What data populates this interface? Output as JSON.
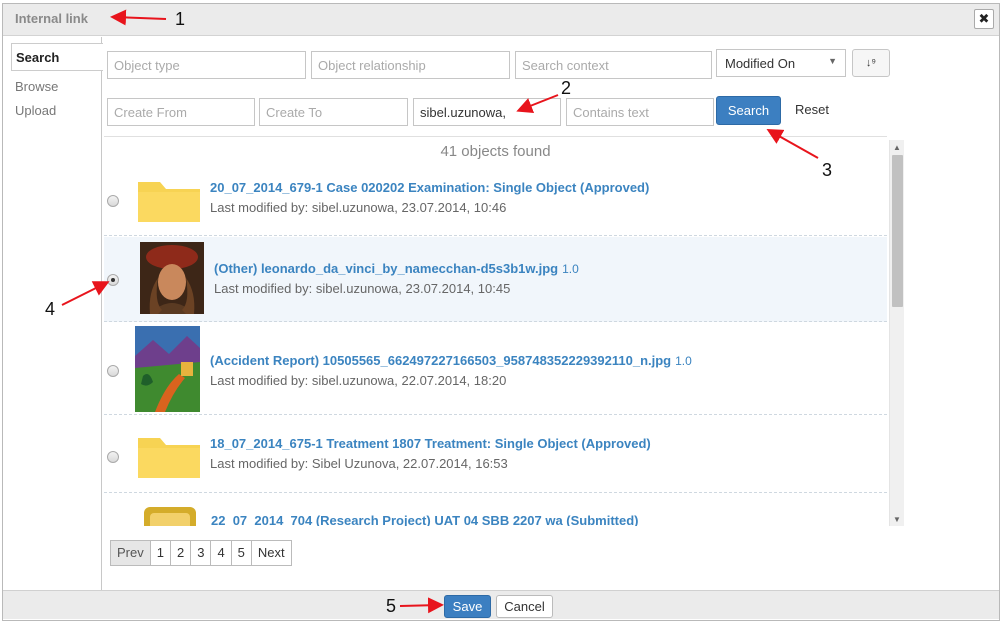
{
  "dialog": {
    "title": "Internal link",
    "close_glyph": "✖"
  },
  "sidebar": {
    "items": [
      {
        "label": "Search"
      },
      {
        "label": "Browse"
      },
      {
        "label": "Upload"
      }
    ]
  },
  "filters": {
    "object_type": "Object type",
    "object_relationship": "Object relationship",
    "search_context": "Search context",
    "sort_by": "Modified On",
    "sort_glyph": "↓⁹",
    "create_from": "Create From",
    "create_to": "Create To",
    "user": "sibel.uzunowa,",
    "contains_text": "Contains text",
    "search_label": "Search",
    "reset_label": "Reset"
  },
  "results": {
    "count_text": "41 objects found",
    "items": [
      {
        "title": "20_07_2014_679-1 Case 020202 Examination: Single Object (Approved)",
        "version": "",
        "modified": "Last modified by: sibel.uzunowa, 23.07.2014, 10:46",
        "thumbnail": "folder-icon"
      },
      {
        "title": "(Other) leonardo_da_vinci_by_namecchan-d5s3b1w.jpg",
        "version": "1.0",
        "modified": "Last modified by: sibel.uzunowa, 23.07.2014, 10:45",
        "thumbnail": "portrait-thumbnail"
      },
      {
        "title": "(Accident Report) 10505565_662497227166503_958748352229392110_n.jpg",
        "version": "1.0",
        "modified": "Last modified by: sibel.uzunowa, 22.07.2014, 18:20",
        "thumbnail": "landscape-thumbnail"
      },
      {
        "title": "18_07_2014_675-1 Treatment 1807 Treatment: Single Object (Approved)",
        "version": "",
        "modified": "Last modified by: Sibel Uzunova, 22.07.2014, 16:53",
        "thumbnail": "folder-icon"
      },
      {
        "title": "22_07_2014_704 (Research Project) UAT 04 SBB 2207 wa (Submitted)",
        "version": "",
        "modified": "",
        "thumbnail": "project-folder-icon"
      }
    ],
    "selected_index": 1
  },
  "pagination": {
    "prev": "Prev",
    "pages": [
      "1",
      "2",
      "3",
      "4",
      "5"
    ],
    "next": "Next"
  },
  "footer": {
    "save": "Save",
    "cancel": "Cancel"
  },
  "callouts": [
    "1",
    "2",
    "3",
    "4",
    "5"
  ],
  "colors": {
    "accent": "#3c7fc1",
    "link": "#3b84c0",
    "annotation_arrow": "#e8141c",
    "folder": "#f7d353"
  }
}
